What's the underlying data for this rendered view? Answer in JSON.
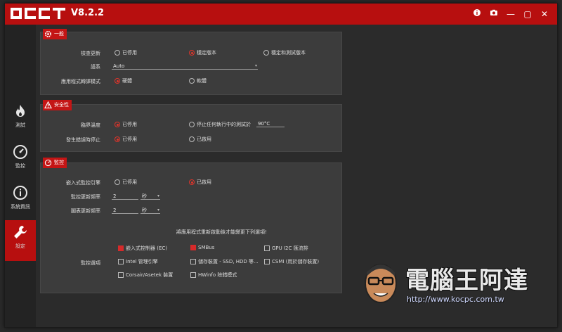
{
  "app": {
    "logo_text": "OCCT",
    "version": "V8.2.2"
  },
  "window_controls": {
    "info_icon": "info-icon",
    "camera_icon": "camera-icon",
    "minimize_glyph": "—",
    "maximize_glyph": "▢",
    "close_glyph": "✕"
  },
  "sidebar": {
    "items": [
      {
        "label": "測試",
        "icon": "flame-icon",
        "active": false
      },
      {
        "label": "監控",
        "icon": "gauge-icon",
        "active": false
      },
      {
        "label": "系統資訊",
        "icon": "info-circle-icon",
        "active": false
      },
      {
        "label": "設定",
        "icon": "wrench-icon",
        "active": true
      }
    ]
  },
  "general": {
    "title": "一般",
    "check_updates_label": "檢查更新",
    "check_updates_options": [
      "已停用",
      "穩定版本",
      "穩定和測試版本"
    ],
    "check_updates_selected": 1,
    "language_label": "語系",
    "language_value": "Auto",
    "app_render_label": "應用程式轉譯模式",
    "app_render_options": [
      "硬體",
      "軟體"
    ],
    "app_render_selected": 0
  },
  "safety": {
    "title": "安全性",
    "critical_temp_label": "臨界溫度",
    "critical_temp_options": [
      "已停用",
      "停止任何執行中的測試於"
    ],
    "critical_temp_selected": 0,
    "critical_temp_value": "90°C",
    "stop_on_error_label": "發生錯誤時停止",
    "stop_on_error_options": [
      "已停用",
      "已啟用"
    ],
    "stop_on_error_selected": 0
  },
  "monitoring": {
    "title": "監控",
    "embedded_engine_label": "嵌入式監控引擎",
    "embedded_engine_options": [
      "已停用",
      "已啟用"
    ],
    "embedded_engine_selected": 1,
    "monitor_rate_label": "監控更新頻率",
    "monitor_rate_value": "2",
    "monitor_rate_unit": "秒",
    "graph_rate_label": "圖表更新頻率",
    "graph_rate_value": "2",
    "graph_rate_unit": "秒",
    "restart_note": "將應用程式重新啟動後才能變更下列選項!",
    "options_label": "監控選項",
    "checkboxes": [
      {
        "label": "嵌入式控制器 (EC)",
        "checked": true
      },
      {
        "label": "SMBus",
        "checked": true
      },
      {
        "label": "GPU I2C 匯流排",
        "checked": false
      },
      {
        "label": "Intel 管理引擎",
        "checked": false
      },
      {
        "label": "儲存裝置 - SSD, HDD 等...",
        "checked": false
      },
      {
        "label": "CSMI (用於儲存裝置)",
        "checked": false
      },
      {
        "label": "Corsair/Asetek 裝置",
        "checked": false
      },
      {
        "label": "HWinfo 除錯模式",
        "checked": false
      }
    ]
  },
  "watermark": {
    "text": "電腦王阿達",
    "url": "http://www.kocpc.com.tw"
  },
  "colors": {
    "accent": "#b70f0f",
    "panel": "#3c3c3c",
    "background": "#2b2b2b"
  }
}
